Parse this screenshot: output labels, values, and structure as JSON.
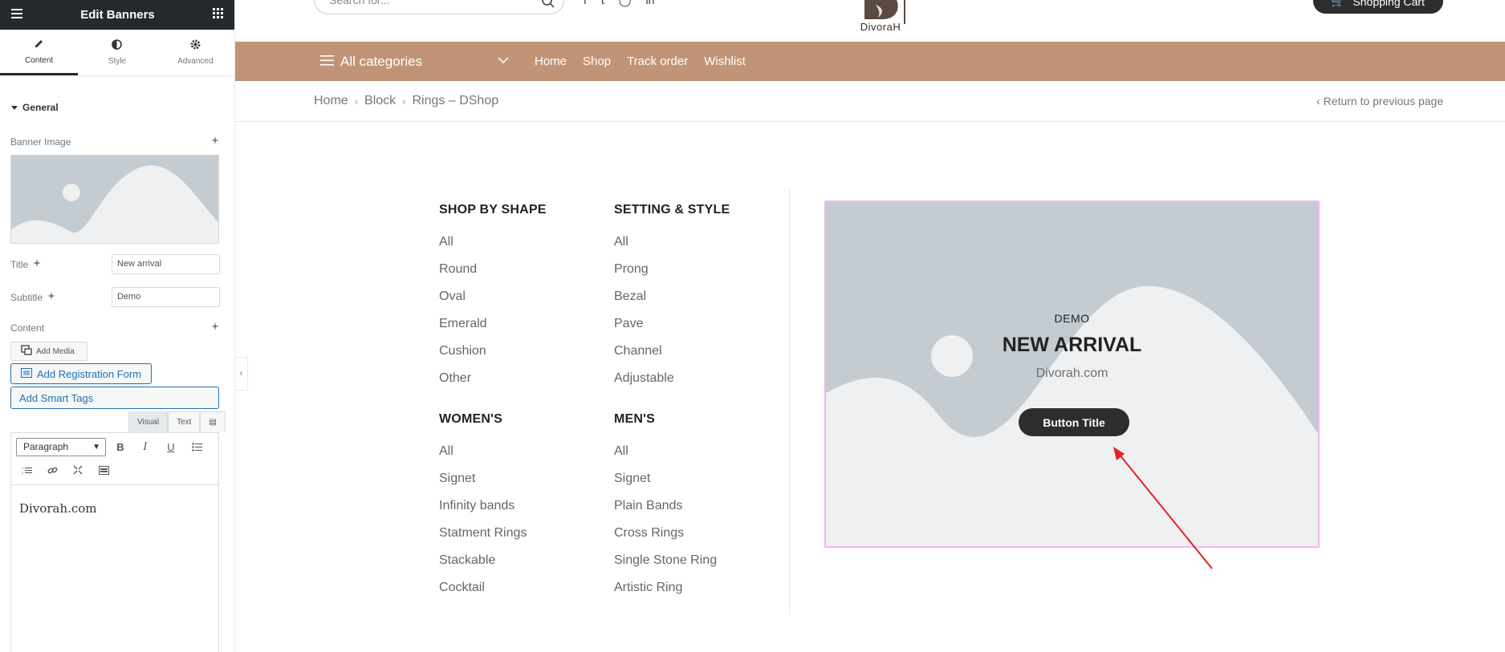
{
  "panel": {
    "title": "Edit Banners",
    "tabs": [
      {
        "label": "Content",
        "icon": "pencil-icon",
        "active": true
      },
      {
        "label": "Style",
        "icon": "half-circle-icon",
        "active": false
      },
      {
        "label": "Advanced",
        "icon": "gear-icon",
        "active": false
      }
    ],
    "section_title": "General",
    "banner_image_label": "Banner Image",
    "title_label": "Title",
    "title_value": "New arrival",
    "subtitle_label": "Subtitle",
    "subtitle_value": "Demo",
    "content_label": "Content",
    "add_media": "Add Media",
    "add_registration_form": "Add Registration Form",
    "add_smart_tags": "Add Smart Tags",
    "editor_tabs": [
      "Visual",
      "Text"
    ],
    "format_select": "Paragraph",
    "editor_content": "Divorah.com"
  },
  "site": {
    "search_placeholder": "Search for...",
    "logo_text": "DivoraH",
    "cart_label": "Shopping Cart",
    "nav": {
      "categories_label": "All categories",
      "links": [
        "Home",
        "Shop",
        "Track order",
        "Wishlist"
      ]
    },
    "breadcrumb": [
      "Home",
      "Block",
      "Rings – DShop"
    ],
    "return_label": "Return to previous page",
    "menu": {
      "shop_by_shape": {
        "heading": "SHOP BY SHAPE",
        "items": [
          "All",
          "Round",
          "Oval",
          "Emerald",
          "Cushion",
          "Other"
        ]
      },
      "setting_style": {
        "heading": "SETTING & STYLE",
        "items": [
          "All",
          "Prong",
          "Bezal",
          "Pave",
          "Channel",
          "Adjustable"
        ]
      },
      "womens": {
        "heading": "WOMEN'S",
        "items": [
          "All",
          "Signet",
          "Infinity bands",
          "Statment Rings",
          "Stackable",
          "Cocktail"
        ]
      },
      "mens": {
        "heading": "MEN'S",
        "items": [
          "All",
          "Signet",
          "Plain Bands",
          "Cross Rings",
          "Single Stone Ring",
          "Artistic Ring"
        ]
      }
    },
    "banner": {
      "subtitle": "Demo",
      "title": "New arrival",
      "description": "Divorah.com",
      "button": "Button Title"
    },
    "colors": {
      "nav_bg": "#c29477",
      "banner_outline": "#f7b2f2",
      "annotation_arrow": "#e32222"
    }
  }
}
